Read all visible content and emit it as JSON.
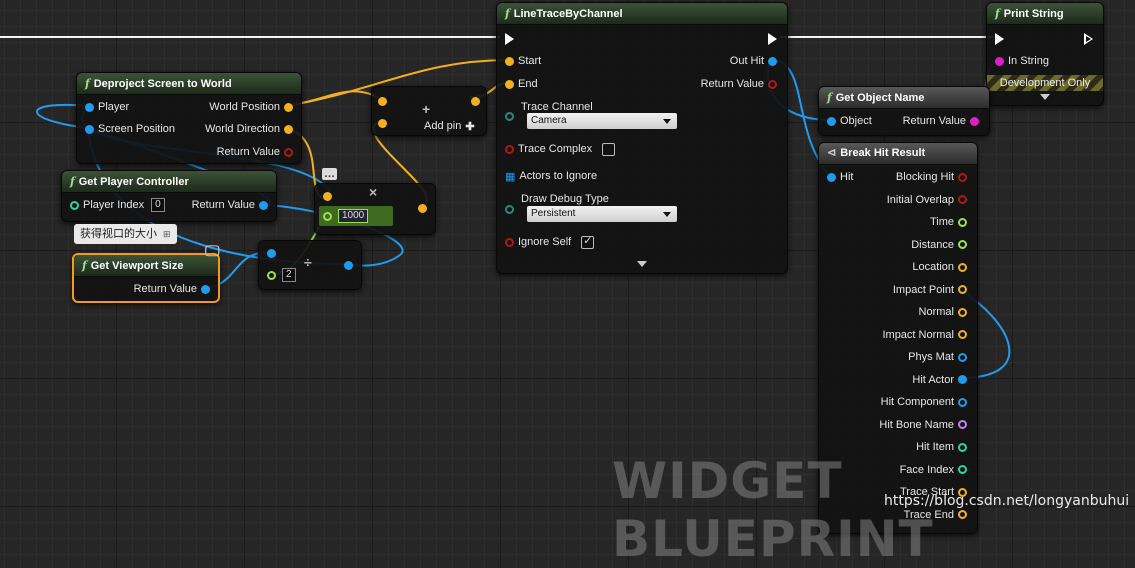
{
  "nodes": {
    "deproject": {
      "title": "Deproject Screen to World",
      "inputs": [
        "Player",
        "Screen Position"
      ],
      "outputs": [
        "World Position",
        "World Direction",
        "Return Value"
      ]
    },
    "get_player_controller": {
      "title": "Get Player Controller",
      "player_index_label": "Player Index",
      "player_index_value": "0",
      "output": "Return Value"
    },
    "comment": "获得视口的大小",
    "get_viewport_size": {
      "title": "Get Viewport Size",
      "output": "Return Value"
    },
    "divide": {
      "symbol": "÷",
      "value": "2"
    },
    "multiply": {
      "symbol": "×",
      "value": "1000"
    },
    "add": {
      "symbol": "+",
      "add_pin_label": "Add pin"
    },
    "line_trace": {
      "title": "LineTraceByChannel",
      "inputs": [
        "Start",
        "End"
      ],
      "outputs": [
        "Out Hit",
        "Return Value"
      ],
      "trace_channel_label": "Trace Channel",
      "trace_channel_value": "Camera",
      "trace_complex_label": "Trace Complex",
      "actors_to_ignore_label": "Actors to Ignore",
      "draw_debug_label": "Draw Debug Type",
      "draw_debug_value": "Persistent",
      "ignore_self_label": "Ignore Self"
    },
    "get_object_name": {
      "title": "Get Object Name",
      "input": "Object",
      "output": "Return Value"
    },
    "print_string": {
      "title": "Print String",
      "input": "In String",
      "dev_only": "Development Only"
    },
    "break_hit": {
      "title": "Break Hit Result",
      "input": "Hit",
      "outputs": [
        {
          "label": "Blocking Hit",
          "color": "#b01818"
        },
        {
          "label": "Initial Overlap",
          "color": "#b01818"
        },
        {
          "label": "Time",
          "color": "#9ee04e"
        },
        {
          "label": "Distance",
          "color": "#9ee04e"
        },
        {
          "label": "Location",
          "color": "#f2b01e"
        },
        {
          "label": "Impact Point",
          "color": "#f2b01e"
        },
        {
          "label": "Normal",
          "color": "#f2b01e"
        },
        {
          "label": "Impact Normal",
          "color": "#f2b01e"
        },
        {
          "label": "Phys Mat",
          "color": "#1e9cf0"
        },
        {
          "label": "Hit Actor",
          "color": "#1e9cf0"
        },
        {
          "label": "Hit Component",
          "color": "#1e9cf0"
        },
        {
          "label": "Hit Bone Name",
          "color": "#c27ff0"
        },
        {
          "label": "Hit Item",
          "color": "#2ad6a6"
        },
        {
          "label": "Face Index",
          "color": "#2ad6a6"
        },
        {
          "label": "Trace Start",
          "color": "#f2b01e"
        },
        {
          "label": "Trace End",
          "color": "#f2b01e"
        }
      ]
    }
  },
  "watermark": "WIDGET BLUEPRINT",
  "url": "https://blog.csdn.net/longyanbuhui"
}
